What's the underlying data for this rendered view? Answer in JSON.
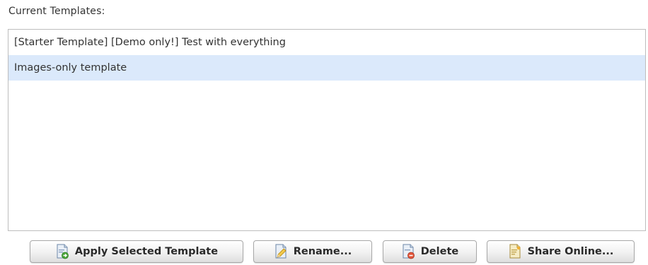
{
  "section_label": "Current Templates:",
  "templates": {
    "items": [
      {
        "label": "[Starter Template] [Demo only!] Test with everything",
        "selected": false
      },
      {
        "label": "Images-only template",
        "selected": true
      }
    ]
  },
  "buttons": {
    "apply": {
      "label": "Apply Selected Template",
      "icon": "apply-template-icon"
    },
    "rename": {
      "label": "Rename...",
      "icon": "rename-pencil-icon"
    },
    "delete": {
      "label": "Delete",
      "icon": "delete-document-icon"
    },
    "share": {
      "label": "Share Online...",
      "icon": "share-online-icon"
    }
  },
  "colors": {
    "selection": "#dbe9fb",
    "border": "#bdbdbd",
    "text": "#333333"
  }
}
